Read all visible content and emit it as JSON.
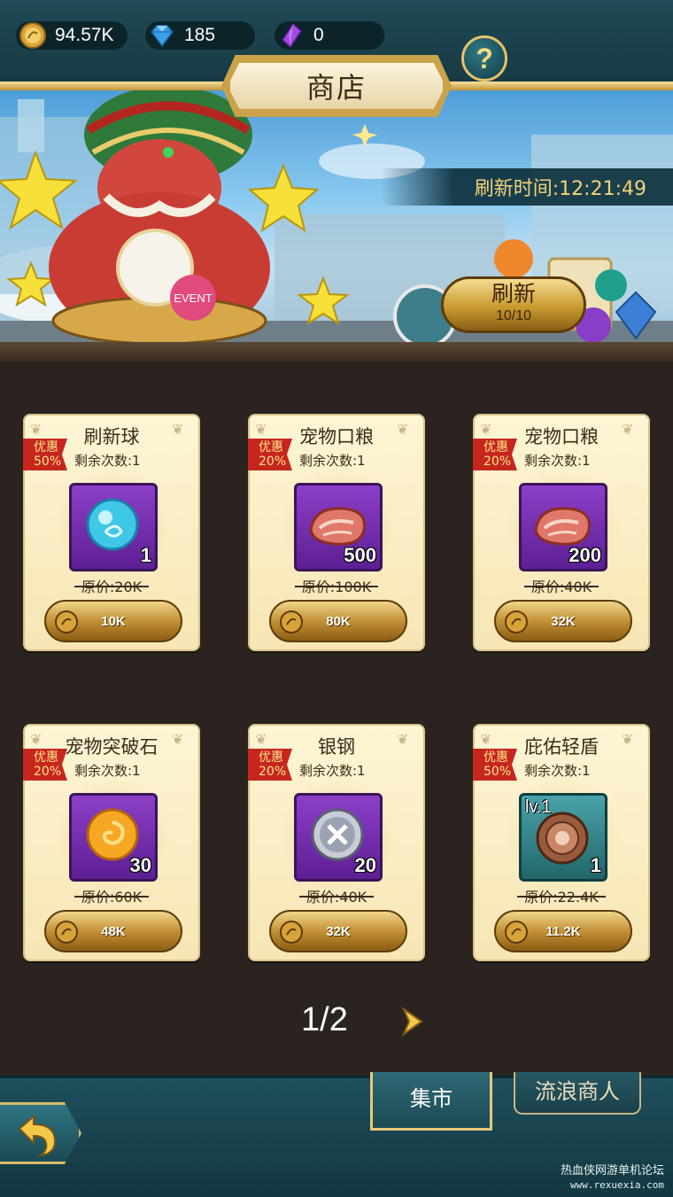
{
  "resources": {
    "gold": "94.57K",
    "gems": "185",
    "crystals": "0"
  },
  "header": {
    "title": "商店",
    "help_label": "?"
  },
  "banner": {
    "refresh_time": "刷新时间:12:21:49",
    "refresh_button_label": "刷新",
    "refresh_count": "10/10",
    "event_badge": "EVENT"
  },
  "shop_items": [
    {
      "name": "刷新球",
      "discount": "优惠\n50%",
      "remaining": "剩余次数:1",
      "qty": "1",
      "original_price": "原价:20K",
      "price": "10K",
      "icon": "blue-orb-icon"
    },
    {
      "name": "宠物口粮",
      "discount": "优惠\n20%",
      "remaining": "剩余次数:1",
      "qty": "500",
      "original_price": "原价:100K",
      "price": "80K",
      "icon": "meat-icon"
    },
    {
      "name": "宠物口粮",
      "discount": "优惠\n20%",
      "remaining": "剩余次数:1",
      "qty": "200",
      "original_price": "原价:40K",
      "price": "32K",
      "icon": "meat-icon"
    },
    {
      "name": "宠物突破石",
      "discount": "优惠\n20%",
      "remaining": "剩余次数:1",
      "qty": "30",
      "original_price": "原价:60K",
      "price": "48K",
      "icon": "orange-orb-icon"
    },
    {
      "name": "银钢",
      "discount": "优惠\n20%",
      "remaining": "剩余次数:1",
      "qty": "20",
      "original_price": "原价:40K",
      "price": "32K",
      "icon": "silver-steel-icon"
    },
    {
      "name": "庇佑轻盾",
      "discount": "优惠\n50%",
      "remaining": "剩余次数:1",
      "qty": "1",
      "level": "lv.1",
      "original_price": "原价:22.4K",
      "price": "11.2K",
      "icon": "shield-icon"
    }
  ],
  "pager": {
    "label": "1/2"
  },
  "tabs": {
    "market": "集市",
    "wandering_merchant": "流浪商人"
  },
  "watermark": {
    "line1": "热血侠网游单机论坛",
    "line2": "www.rexuexia.com"
  },
  "colors": {
    "gold_accent": "#f2d27a",
    "discount_tag": "#c7261e",
    "item_purple": "#8c3fc7",
    "panel_dark": "#2a231f",
    "teal_bar": "#1e4f5b"
  }
}
